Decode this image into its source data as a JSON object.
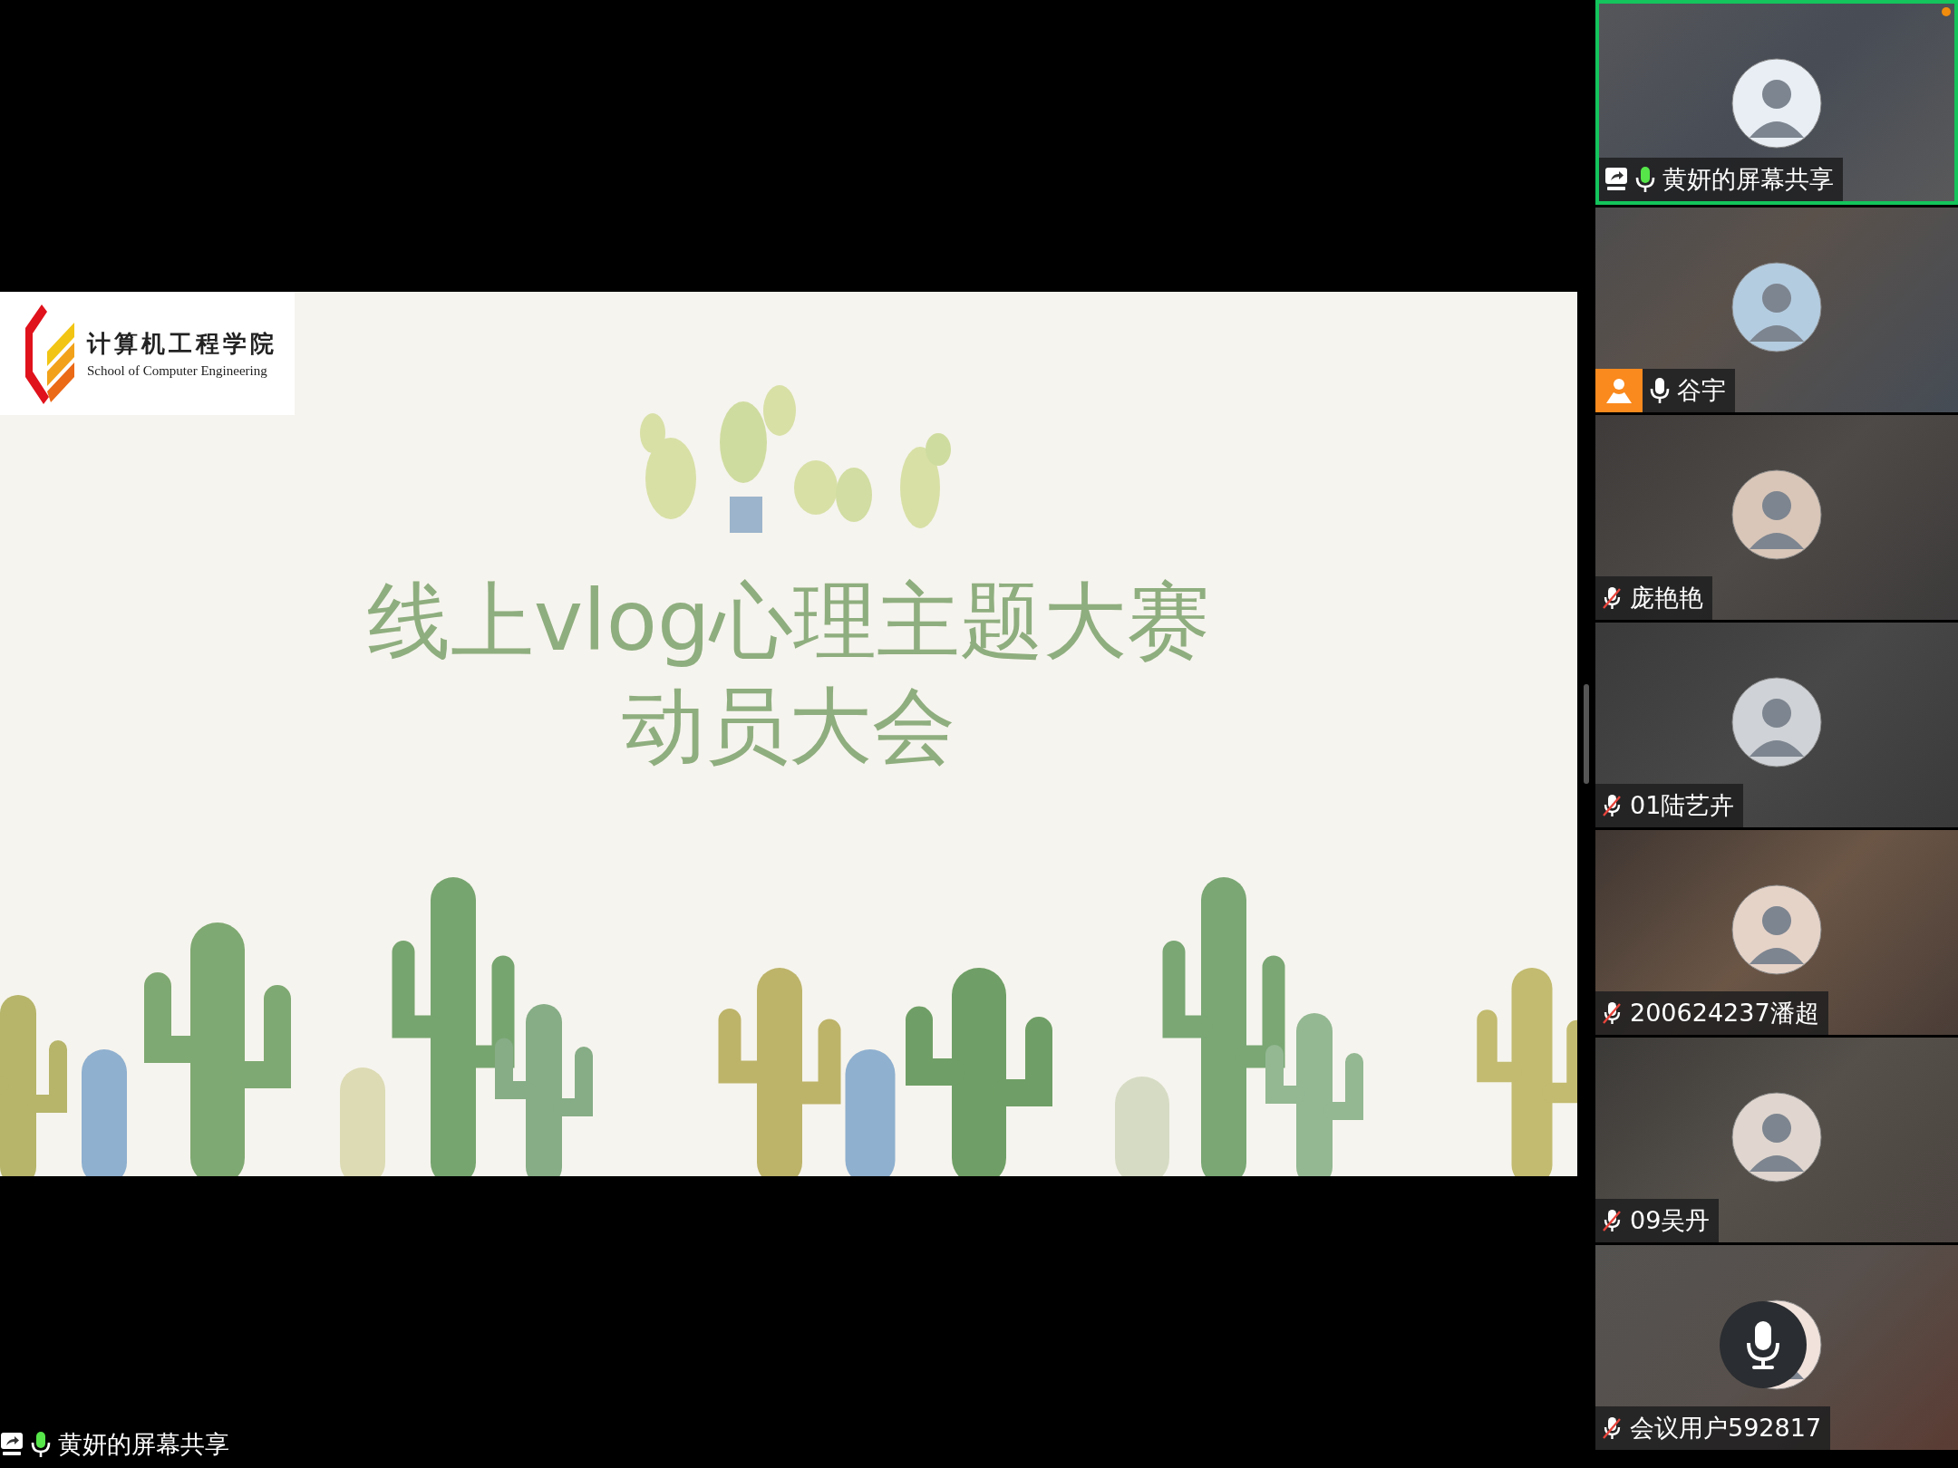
{
  "slide": {
    "logo": {
      "name_cn": "计算机工程学院",
      "name_en": "School of Computer Engineering"
    },
    "title_lines": [
      "线上vlog心理主题大赛",
      "动员大会"
    ]
  },
  "presenter_label": {
    "name": "黄妍的屏幕共享",
    "muted": false,
    "speaking": true,
    "screen_sharing": true
  },
  "participants": [
    {
      "name": "黄妍的屏幕共享",
      "muted": false,
      "speaking": true,
      "screen_sharing": true,
      "host": false,
      "selected": true,
      "mic_overlay": false
    },
    {
      "name": "谷宇",
      "muted": false,
      "speaking": false,
      "screen_sharing": false,
      "host": true,
      "selected": false,
      "mic_overlay": false
    },
    {
      "name": "庞艳艳",
      "muted": true,
      "speaking": false,
      "screen_sharing": false,
      "host": false,
      "selected": false,
      "mic_overlay": false
    },
    {
      "name": "01陆艺卉",
      "muted": true,
      "speaking": false,
      "screen_sharing": false,
      "host": false,
      "selected": false,
      "mic_overlay": false
    },
    {
      "name": "200624237潘超",
      "muted": true,
      "speaking": false,
      "screen_sharing": false,
      "host": false,
      "selected": false,
      "mic_overlay": false
    },
    {
      "name": "09吴丹",
      "muted": true,
      "speaking": false,
      "screen_sharing": false,
      "host": false,
      "selected": false,
      "mic_overlay": false
    },
    {
      "name": "会议用户592817",
      "muted": true,
      "speaking": false,
      "screen_sharing": false,
      "host": false,
      "selected": false,
      "mic_overlay": true
    }
  ]
}
